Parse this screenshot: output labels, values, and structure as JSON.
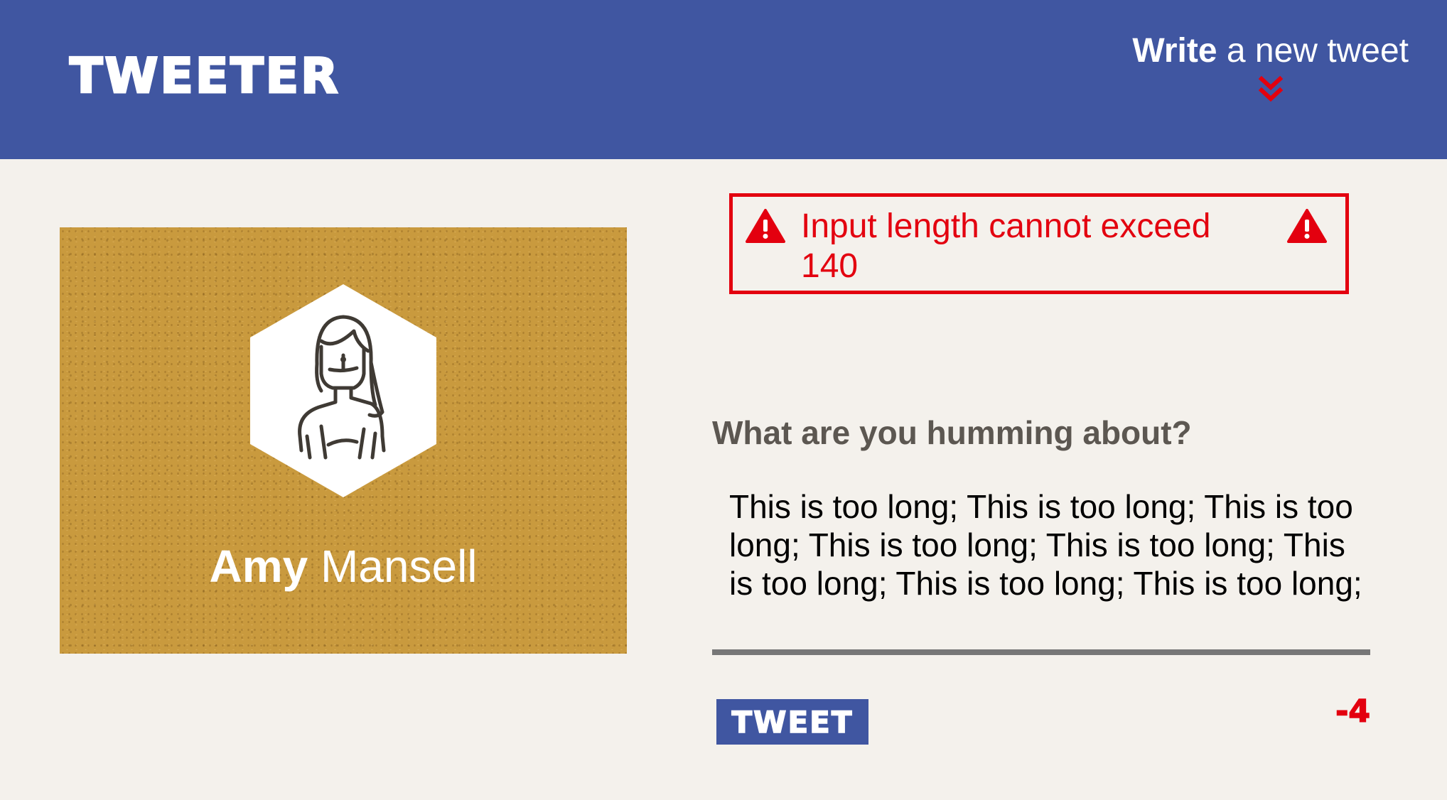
{
  "colors": {
    "nav_bg": "#4056a1",
    "page_bg": "#f4f1ec",
    "profile_bg": "#c99a3e",
    "error": "#e3000f",
    "prompt_text": "#5c5751",
    "input_border": "#777777"
  },
  "nav": {
    "brand": "TWEETER",
    "compose_bold": "Write",
    "compose_rest": " a new tweet",
    "compose_icon": "double-chevron-down-icon"
  },
  "profile": {
    "first_name": "Amy",
    "last_name": " Mansell",
    "avatar_icon": "woman-avatar-icon"
  },
  "error": {
    "message": "Input length cannot exceed 140",
    "icon": "warning-triangle-icon"
  },
  "composer": {
    "prompt": "What are you humming about?",
    "value": "This is too long; This is too long; This is too long; This is too long; This is too long; This is too long; This is too long; This is too long;",
    "button_label": "TWEET",
    "counter": "-4"
  }
}
